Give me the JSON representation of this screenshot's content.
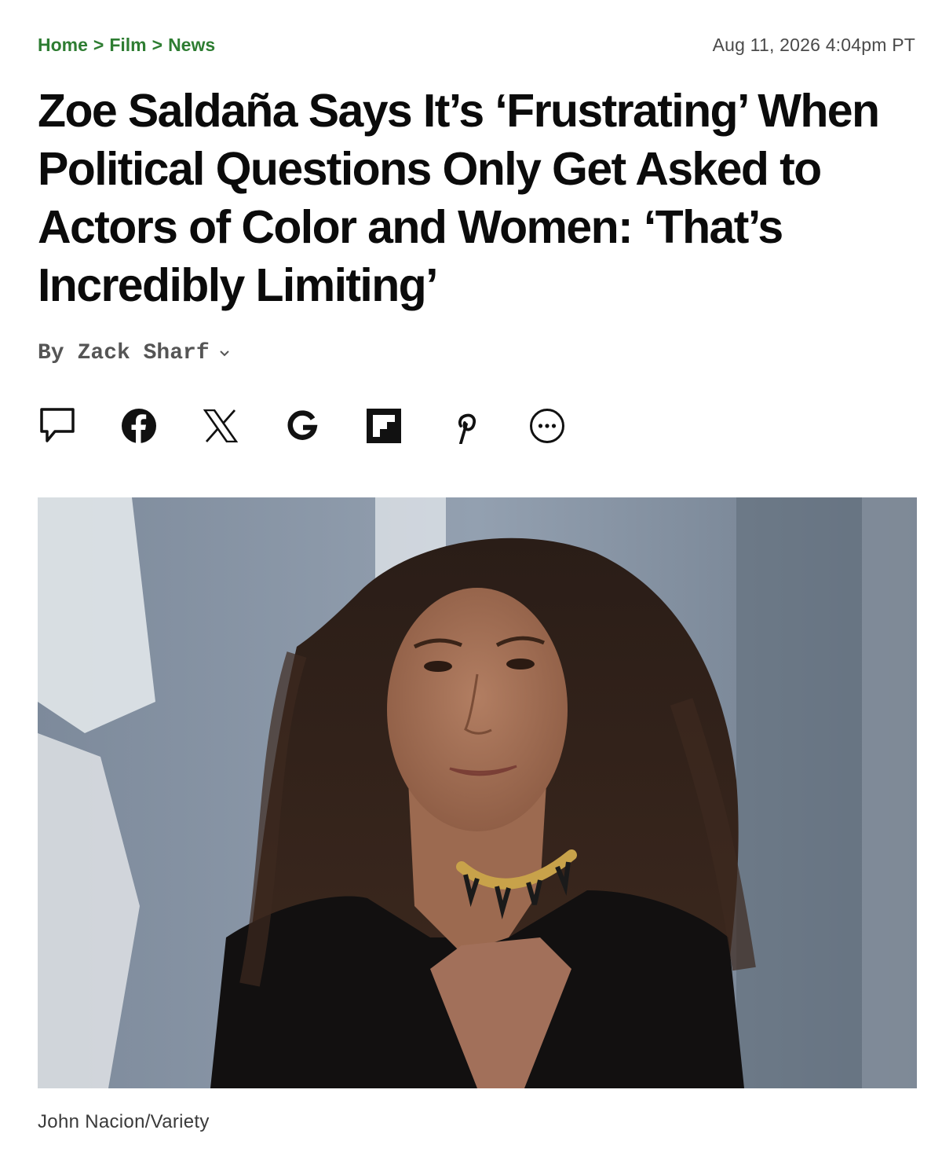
{
  "breadcrumb": {
    "items": [
      "Home",
      "Film",
      "News"
    ],
    "separator": ">"
  },
  "timestamp": "Aug 11, 2026 4:04pm PT",
  "headline": "Zoe Saldaña Says It’s ‘Frustrating’ When Political Questions Only Get Asked to Actors of Color and Women: ‘That’s Incredibly Limiting’",
  "byline": {
    "prefix": "By",
    "author": "Zack Sharf"
  },
  "share_icons": [
    "comment-icon",
    "facebook-icon",
    "x-icon",
    "google-icon",
    "flipboard-icon",
    "pinterest-icon",
    "more-icon"
  ],
  "photo": {
    "caption": "John Nacion/Variety"
  },
  "colors": {
    "breadcrumb": "#2e7d32",
    "headline": "#0b0b0b",
    "meta": "#4a4a4a"
  }
}
